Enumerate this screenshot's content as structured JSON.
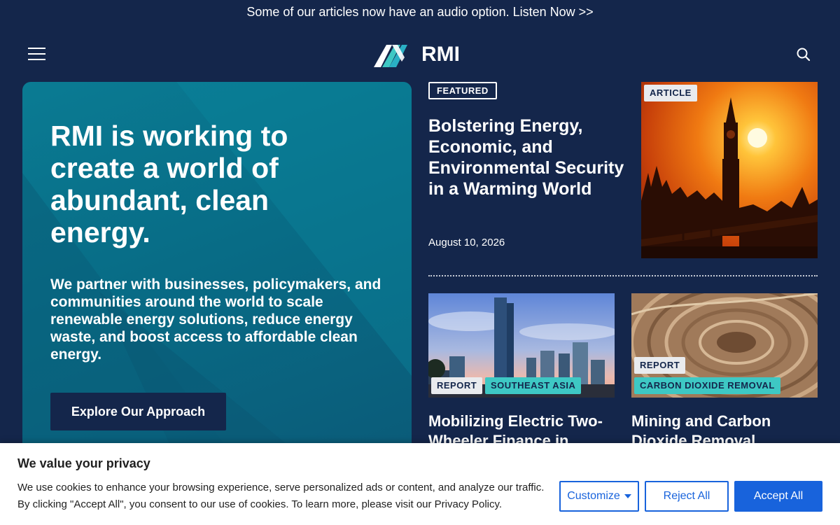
{
  "announcement": {
    "text": "Some of our articles now have an audio option. Listen Now >>"
  },
  "header": {
    "logo_text": "RMI"
  },
  "hero": {
    "title": "RMI is working to create a world of abundant, clean energy.",
    "description": "We partner with businesses, policymakers, and communities around the world to scale renewable energy solutions, reduce energy waste, and boost access to affordable clean energy.",
    "cta_label": "Explore Our Approach"
  },
  "featured": {
    "badge": "FEATURED",
    "title": "Bolstering Energy, Economic, and Environmental Security in a Warming World",
    "date": "August 10, 2026",
    "image_tag": "ARTICLE"
  },
  "cards": [
    {
      "type_tag": "REPORT",
      "topic_tag": "SOUTHEAST ASIA",
      "title": "Mobilizing Electric Two-Wheeler Finance in"
    },
    {
      "type_tag": "REPORT",
      "topic_tag": "CARBON DIOXIDE REMOVAL",
      "title": "Mining and Carbon Dioxide Removal"
    }
  ],
  "cookie_banner": {
    "title": "We value your privacy",
    "text": "We use cookies to enhance your browsing experience, serve personalized ads or content, and analyze our traffic. By clicking \"Accept All\", you consent to our use of cookies. To learn more, please visit our Privacy Policy.",
    "customize_label": "Customize",
    "reject_label": "Reject All",
    "accept_label": "Accept All"
  },
  "colors": {
    "background": "#14264b",
    "hero_teal": "#087a92",
    "tag_teal": "#3ec8c4",
    "button_blue": "#1863dc"
  },
  "icons": [
    "menu-icon",
    "search-icon",
    "rmi-logo-mark",
    "caret-down-icon"
  ]
}
